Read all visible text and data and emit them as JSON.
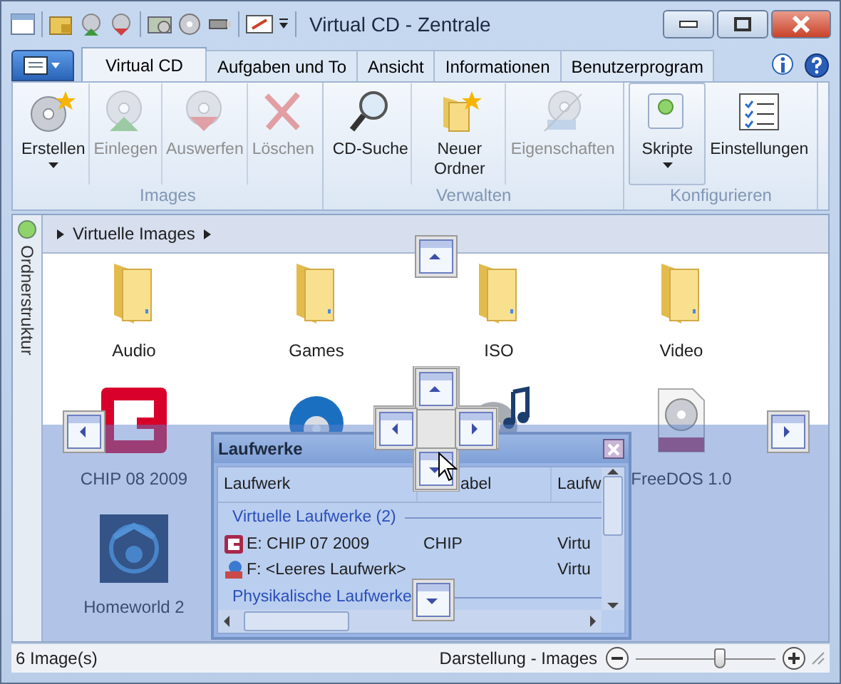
{
  "window": {
    "title": "Virtual CD - Zentrale"
  },
  "tabs": [
    {
      "label": "Virtual CD",
      "selected": true
    },
    {
      "label": "Aufgaben und To",
      "selected": false
    },
    {
      "label": "Ansicht",
      "selected": false
    },
    {
      "label": "Informationen",
      "selected": false
    },
    {
      "label": "Benutzerprogram",
      "selected": false
    }
  ],
  "ribbon": {
    "groups": [
      {
        "label": "Images",
        "buttons": [
          {
            "label": "Erstellen",
            "kind": "create",
            "disabled": false,
            "dropdown": true,
            "pressed": false
          },
          {
            "label": "Einlegen",
            "kind": "insert",
            "disabled": true,
            "dropdown": false,
            "pressed": false
          },
          {
            "label": "Auswerfen",
            "kind": "eject",
            "disabled": true,
            "dropdown": false,
            "pressed": false
          },
          {
            "label": "Löschen",
            "kind": "delete",
            "disabled": true,
            "dropdown": false,
            "pressed": false
          }
        ]
      },
      {
        "label": "Verwalten",
        "buttons": [
          {
            "label": "CD-Suche",
            "kind": "search",
            "disabled": false,
            "dropdown": false,
            "pressed": false
          },
          {
            "label": "Neuer Ordner",
            "kind": "newfolder",
            "disabled": false,
            "dropdown": false,
            "pressed": false
          },
          {
            "label": "Eigenschaften",
            "kind": "properties",
            "disabled": true,
            "dropdown": false,
            "pressed": false
          }
        ]
      },
      {
        "label": "Konfigurieren",
        "buttons": [
          {
            "label": "Skripte",
            "kind": "scripts",
            "disabled": false,
            "dropdown": true,
            "pressed": true
          },
          {
            "label": "Einstellungen",
            "kind": "settings",
            "disabled": false,
            "dropdown": false,
            "pressed": false
          }
        ]
      }
    ]
  },
  "sidebar": {
    "label": "Ordnerstruktur"
  },
  "breadcrumb": {
    "items": [
      "Virtuelle Images"
    ]
  },
  "items": [
    {
      "label": "Audio",
      "kind": "folder"
    },
    {
      "label": "Games",
      "kind": "folder"
    },
    {
      "label": "ISO",
      "kind": "folder"
    },
    {
      "label": "Video",
      "kind": "folder"
    },
    {
      "label": "CHIP 08 2009",
      "kind": "chip"
    },
    {
      "kind": "bluray"
    },
    {
      "kind": "music"
    },
    {
      "label": "FreeDOS 1.0",
      "kind": "iso"
    },
    {
      "label": "Homeworld 2",
      "kind": "game"
    }
  ],
  "drives_panel": {
    "title": "Laufwerke",
    "columns": [
      "Laufwerk",
      "abel",
      "Laufw"
    ],
    "groups": [
      {
        "label": "Virtuelle Laufwerke (2)",
        "rows": [
          {
            "kind": "chip",
            "drive": "E: CHIP 07 2009",
            "label": "CHIP",
            "type": "Virtu"
          },
          {
            "kind": "drive",
            "drive": "F: <Leeres Laufwerk>",
            "type": "Virtu"
          }
        ]
      },
      {
        "label": "Physikalische Laufwerke"
      }
    ]
  },
  "status_bar": {
    "count": "6 Image(s)",
    "view": "Darstellung - Images",
    "zoom": {
      "level": 0.6
    }
  }
}
